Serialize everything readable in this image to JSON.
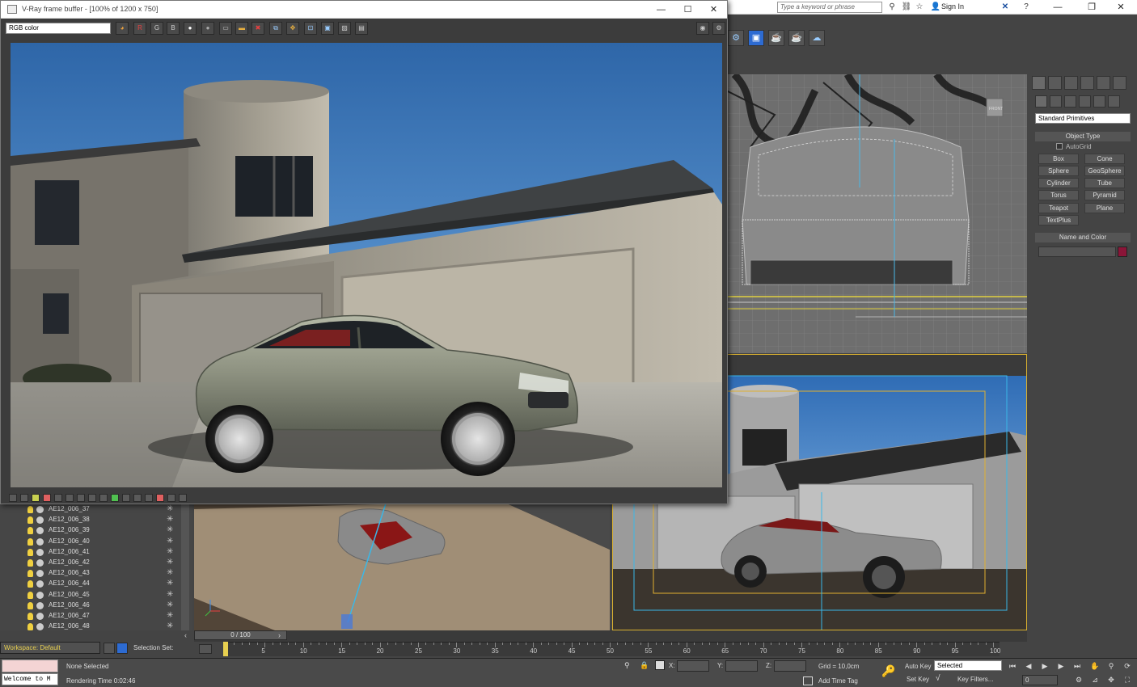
{
  "max_window": {
    "search_placeholder": "Type a keyword or phrase",
    "sign_in": "Sign In",
    "buttons": {
      "minimize": "—",
      "maximize": "❐",
      "close": "✕"
    }
  },
  "vfb": {
    "title": "V-Ray frame buffer - [100% of 1200 x 750]",
    "channel": "RGB color",
    "channel_r": "R",
    "channel_g": "G",
    "channel_b": "B",
    "buttons": {
      "minimize": "—",
      "maximize": "☐",
      "close": "✕"
    }
  },
  "command_panel": {
    "dropdown": "Standard Primitives",
    "object_type_title": "Object Type",
    "autogrid": "AutoGrid",
    "primitives": [
      "Box",
      "Cone",
      "Sphere",
      "GeoSphere",
      "Cylinder",
      "Tube",
      "Torus",
      "Pyramid",
      "Teapot",
      "Plane",
      "TextPlus"
    ],
    "name_color_title": "Name and Color",
    "object_color": "#8b1538"
  },
  "viewports": {
    "front_label": "FRONT"
  },
  "explorer": {
    "items": [
      "AE12_006_37",
      "AE12_006_38",
      "AE12_006_39",
      "AE12_006_40",
      "AE12_006_41",
      "AE12_006_42",
      "AE12_006_43",
      "AE12_006_44",
      "AE12_006_45",
      "AE12_006_46",
      "AE12_006_47",
      "AE12_006_48"
    ]
  },
  "timeline": {
    "slider": "0 / 100",
    "ticks": [
      5,
      10,
      15,
      20,
      25,
      30,
      35,
      40,
      45,
      50,
      55,
      60,
      65,
      70,
      75,
      80,
      85,
      90,
      95,
      100
    ]
  },
  "bottom": {
    "workspace": "Workspace: Default",
    "selection_set": "Selection Set:",
    "welcome": "Welcome to M",
    "selection_status": "None Selected",
    "render_time": "Rendering Time  0:02:46",
    "x_label": "X:",
    "y_label": "Y:",
    "z_label": "Z:",
    "grid": "Grid = 10,0cm",
    "add_time_tag": "Add Time Tag",
    "auto_key": "Auto Key",
    "set_key": "Set Key",
    "selected": "Selected",
    "key_filters": "Key Filters...",
    "frame": "0"
  }
}
